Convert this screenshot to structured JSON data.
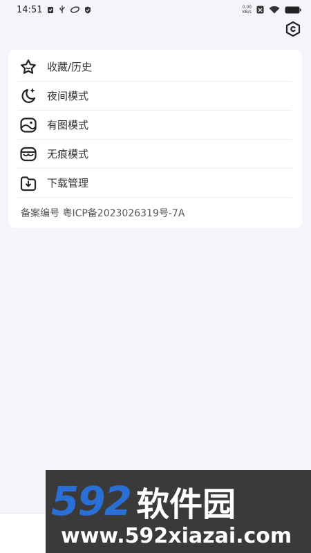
{
  "status_bar": {
    "time": "14:51",
    "speed_value": "0.00",
    "speed_unit": "KB/s"
  },
  "menu": [
    {
      "label": "收藏/历史",
      "icon": "star-icon"
    },
    {
      "label": "夜间模式",
      "icon": "moon-icon"
    },
    {
      "label": "有图模式",
      "icon": "image-icon"
    },
    {
      "label": "无痕模式",
      "icon": "mask-icon"
    },
    {
      "label": "下载管理",
      "icon": "download-folder-icon"
    }
  ],
  "icp_text": "备案编号 粤ICP备2023026319号-7A",
  "watermark": {
    "number": "592",
    "brand": "软件园",
    "url": "www.592xiazai.com"
  },
  "colors": {
    "background": "#f4f5fa",
    "card": "#ffffff",
    "watermark_blue": "#2a6fd6"
  }
}
